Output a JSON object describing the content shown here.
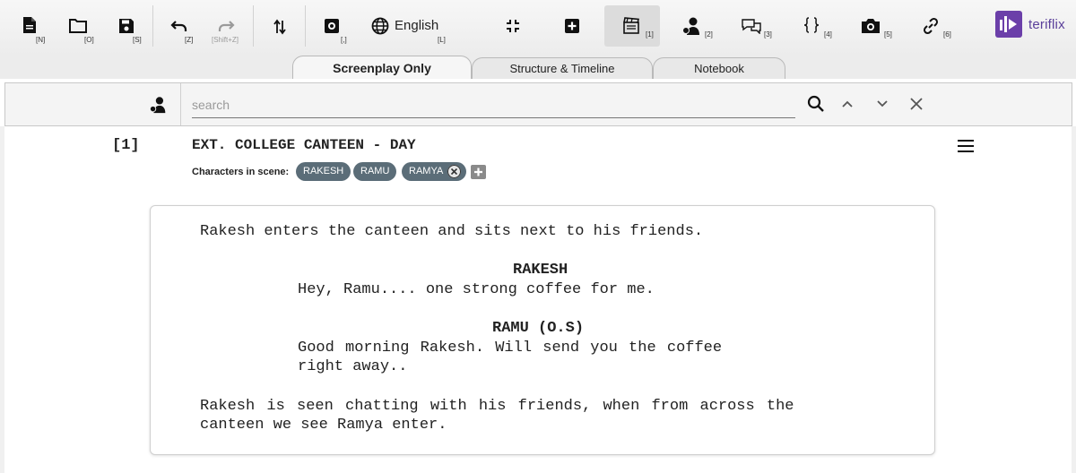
{
  "toolbar": {
    "new_shortcut": "[N]",
    "open_shortcut": "[O]",
    "save_shortcut": "[S]",
    "undo_shortcut": "[Z]",
    "redo_shortcut": "[Shift+Z]",
    "settings_shortcut": "[,]",
    "language_label": "English",
    "language_shortcut": "[L]",
    "scene_shortcut": "[1]",
    "characters_shortcut": "[2]",
    "dialogue_shortcut": "[3]",
    "braces_shortcut": "[4]",
    "camera_shortcut": "[5]",
    "link_shortcut": "[6]"
  },
  "brand": {
    "name": "teriflix",
    "color": "#6b3fa9"
  },
  "tabs": [
    {
      "label": "Screenplay Only",
      "active": true
    },
    {
      "label": "Structure & Timeline",
      "active": false
    },
    {
      "label": "Notebook",
      "active": false
    }
  ],
  "search": {
    "placeholder": "search",
    "value": ""
  },
  "scene": {
    "number": "[1]",
    "heading": "EXT. COLLEGE CANTEEN - DAY",
    "characters_label": "Characters in scene:",
    "characters": [
      "RAKESH",
      "RAMU",
      "RAMYA"
    ],
    "chip_color": "#5b6d78"
  },
  "script": {
    "action1": "Rakesh enters the canteen and sits next to his friends.",
    "char1": "RAKESH",
    "dialogue1": "Hey, Ramu.... one strong coffee for me.",
    "char2": "RAMU (O.S)",
    "dialogue2_line1": "Good morning Rakesh. Will send you the coffee",
    "dialogue2_line2": "right away..",
    "action2_line1": "Rakesh is seen chatting with his friends, when from across the",
    "action2_line2": "canteen we see Ramya enter."
  }
}
